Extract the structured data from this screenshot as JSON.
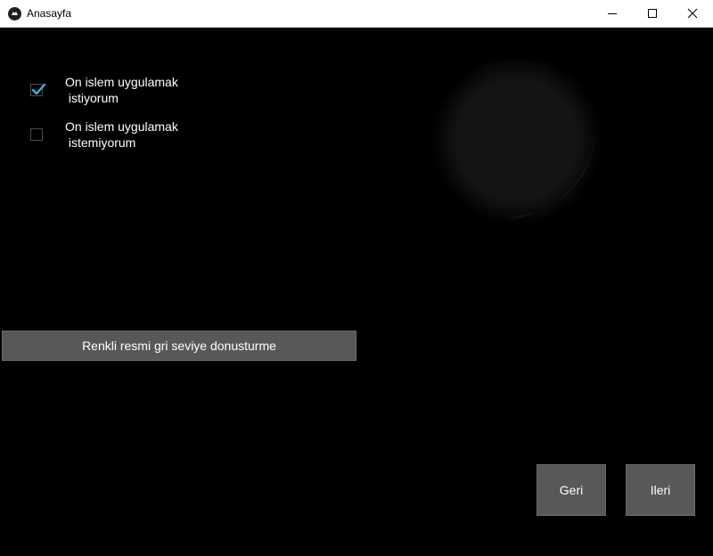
{
  "window": {
    "title": "Anasayfa",
    "controls": {
      "minimize_icon": "minimize-icon",
      "maximize_icon": "maximize-icon",
      "close_icon": "close-icon"
    }
  },
  "options": [
    {
      "label": "On islem uygulamak\n istiyorum",
      "checked": true
    },
    {
      "label": "On islem uygulamak\n istemiyorum",
      "checked": false
    }
  ],
  "convert_button": {
    "label": "Renkli resmi gri seviye donusturme"
  },
  "navigation": {
    "back_label": "Geri",
    "next_label": "Ileri"
  },
  "colors": {
    "background": "#000000",
    "button_bg": "#585858",
    "check_accent": "#33b5e5"
  }
}
